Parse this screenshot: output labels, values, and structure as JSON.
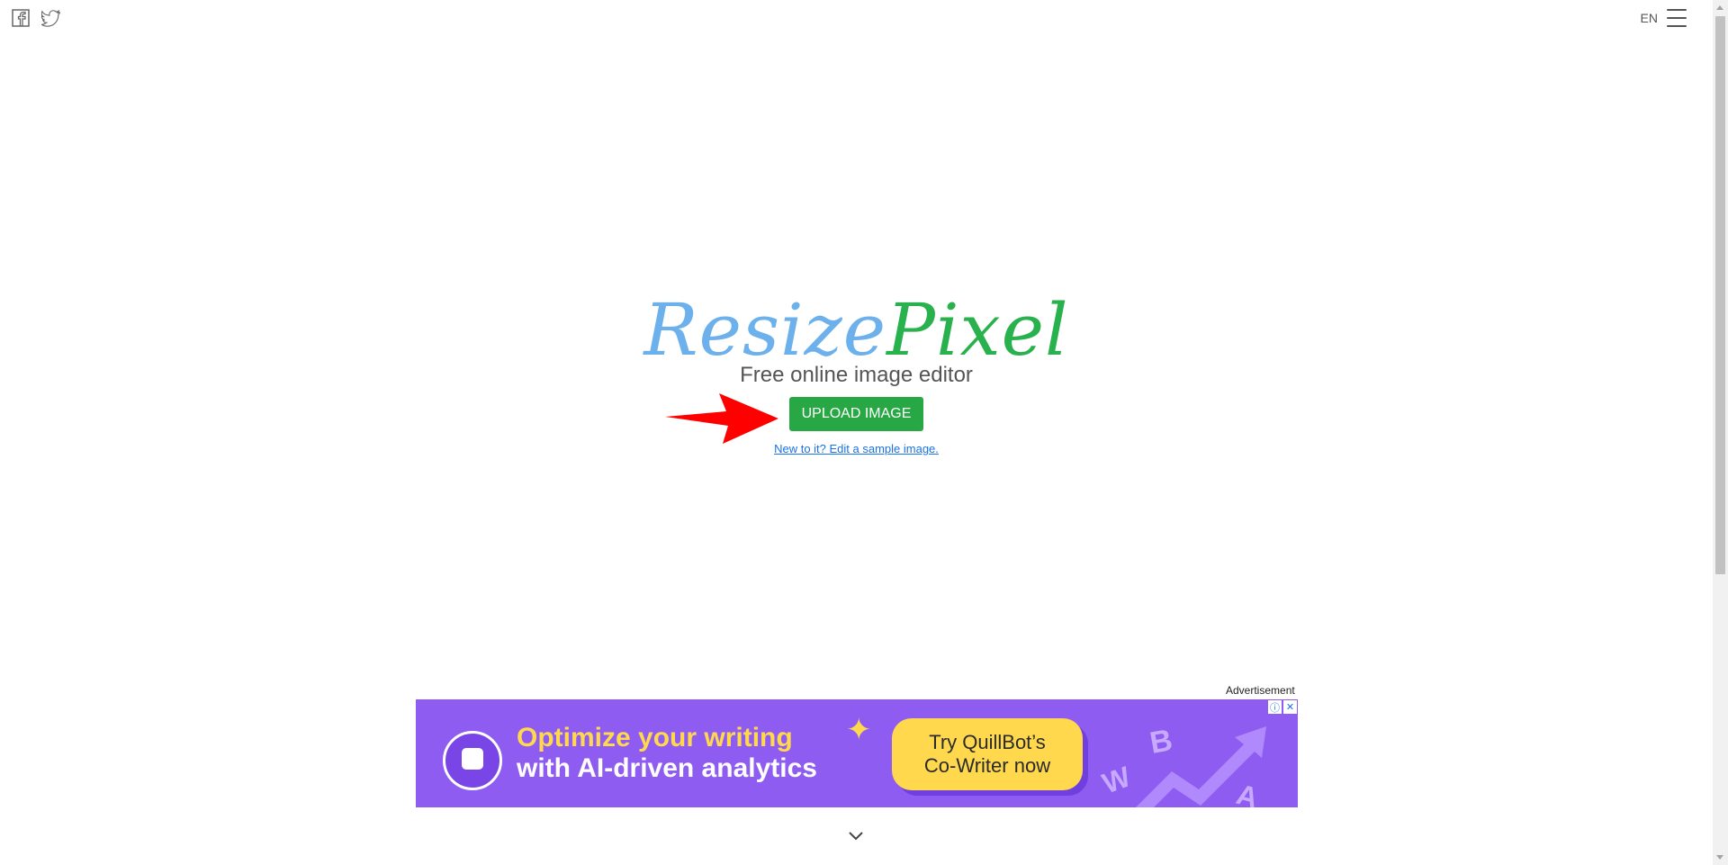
{
  "header": {
    "language": "EN"
  },
  "hero": {
    "logo_part1": "Resize",
    "logo_part2": "Pixel",
    "tagline": "Free online image editor",
    "upload_label": "UPLOAD IMAGE",
    "sample_link": "New to it? Edit a sample image."
  },
  "ad": {
    "label": "Advertisement",
    "headline_1": "Optimize your writing",
    "headline_2": "with AI-driven analytics",
    "cta_1": "Try QuillBot’s",
    "cta_2": "Co-Writer now",
    "deco_letters": [
      "W",
      "B",
      "A"
    ]
  },
  "colors": {
    "logo_blue": "#6cb1eb",
    "logo_green": "#28b14c",
    "upload_green": "#28a745",
    "arrow_red": "#ff0000",
    "ad_purple": "#8e5cf0",
    "ad_yellow": "#ffd84d"
  },
  "icons": [
    "facebook-icon",
    "twitter-icon",
    "menu-icon",
    "red-arrow-icon",
    "chevron-down-icon",
    "ad-info-icon",
    "ad-close-icon"
  ]
}
